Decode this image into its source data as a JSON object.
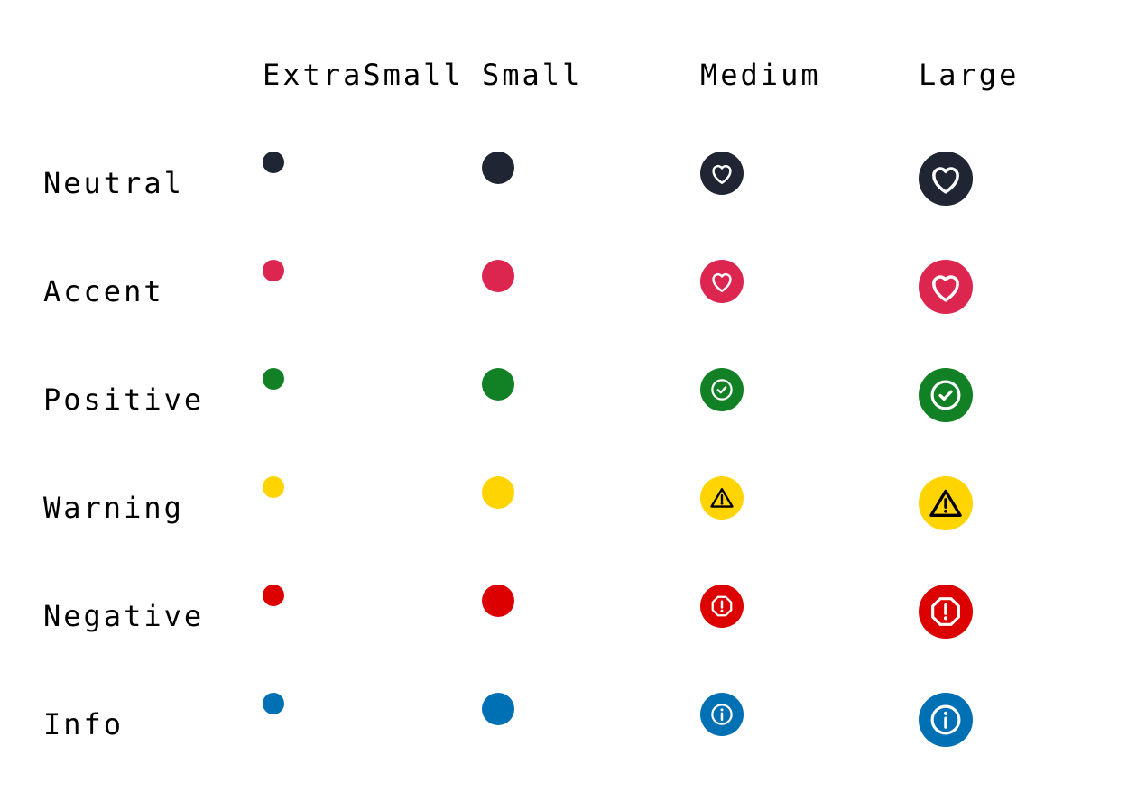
{
  "columns": [
    {
      "key": "xs",
      "label": "ExtraSmall"
    },
    {
      "key": "sm",
      "label": "Small"
    },
    {
      "key": "md",
      "label": "Medium"
    },
    {
      "key": "lg",
      "label": "Large"
    }
  ],
  "rows": [
    {
      "label": "Neutral",
      "color": "#1f2532",
      "icon": "heart-icon",
      "ink": "#ffffff"
    },
    {
      "label": "Accent",
      "color": "#dc2650",
      "icon": "heart-icon",
      "ink": "#ffffff"
    },
    {
      "label": "Positive",
      "color": "#128025",
      "icon": "check-circle-icon",
      "ink": "#ffffff"
    },
    {
      "label": "Warning",
      "color": "#ffd400",
      "icon": "warning-triangle-icon",
      "ink": "#000000"
    },
    {
      "label": "Negative",
      "color": "#dc0000",
      "icon": "alert-octagon-icon",
      "ink": "#ffffff"
    },
    {
      "label": "Info",
      "color": "#0070b4",
      "icon": "info-circle-icon",
      "ink": "#ffffff"
    }
  ]
}
